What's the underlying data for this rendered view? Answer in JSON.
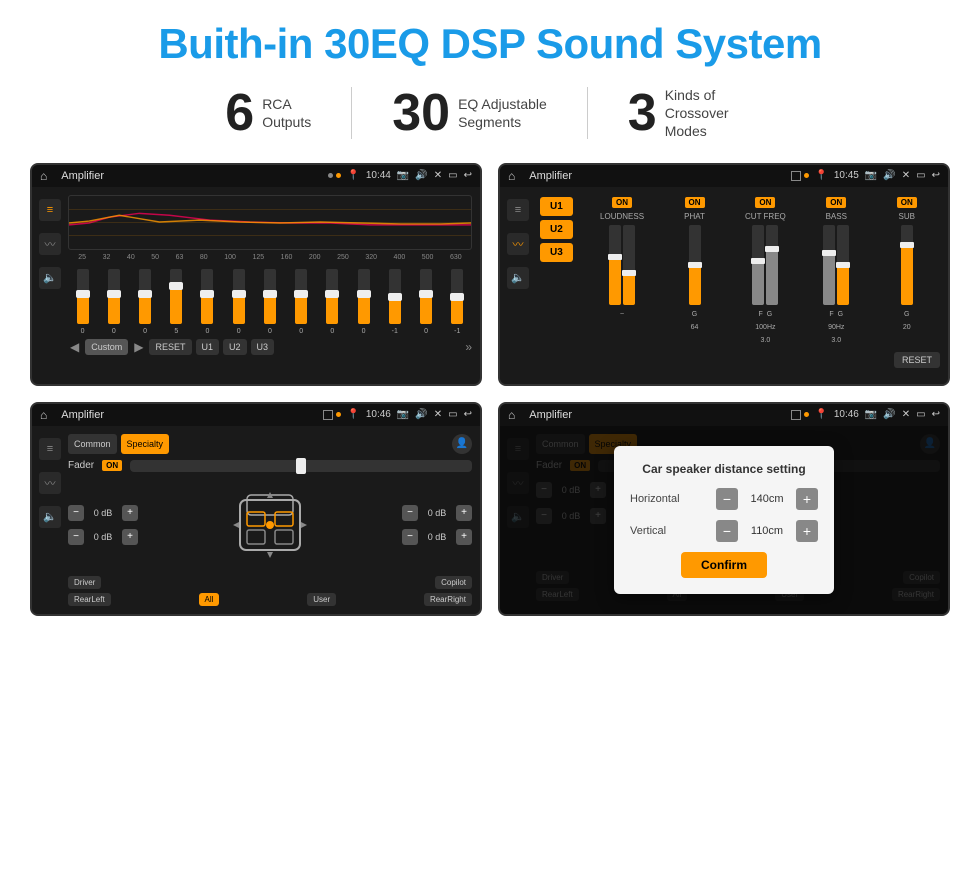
{
  "page": {
    "title": "Buith-in 30EQ DSP Sound System",
    "stats": [
      {
        "number": "6",
        "label": "RCA\nOutputs"
      },
      {
        "number": "30",
        "label": "EQ Adjustable\nSegments"
      },
      {
        "number": "3",
        "label": "Kinds of\nCrossover Modes"
      }
    ]
  },
  "screens": {
    "screen1": {
      "statusBar": {
        "title": "Amplifier",
        "time": "10:44"
      },
      "freqLabels": [
        "25",
        "32",
        "40",
        "50",
        "63",
        "80",
        "100",
        "125",
        "160",
        "200",
        "250",
        "320",
        "400",
        "500",
        "630"
      ],
      "sliderValues": [
        "0",
        "0",
        "0",
        "5",
        "0",
        "0",
        "0",
        "0",
        "0",
        "0",
        "-1",
        "0",
        "-1"
      ],
      "bottomButtons": [
        "Custom",
        "RESET",
        "U1",
        "U2",
        "U3"
      ]
    },
    "screen2": {
      "statusBar": {
        "title": "Amplifier",
        "time": "10:45"
      },
      "presets": [
        "U1",
        "U2",
        "U3"
      ],
      "channels": [
        "LOUDNESS",
        "PHAT",
        "CUT FREQ",
        "BASS",
        "SUB"
      ],
      "resetBtn": "RESET"
    },
    "screen3": {
      "statusBar": {
        "title": "Amplifier",
        "time": "10:46"
      },
      "tabs": [
        "Common",
        "Specialty"
      ],
      "fader": "Fader",
      "volumeRows": [
        {
          "value": "0 dB"
        },
        {
          "value": "0 dB"
        },
        {
          "value": "0 dB"
        },
        {
          "value": "0 dB"
        }
      ],
      "bottomBtns": [
        "Driver",
        "All",
        "User",
        "RearRight",
        "RearLeft",
        "Copilot"
      ]
    },
    "screen4": {
      "statusBar": {
        "title": "Amplifier",
        "time": "10:46"
      },
      "dialog": {
        "title": "Car speaker distance setting",
        "rows": [
          {
            "label": "Horizontal",
            "value": "140cm"
          },
          {
            "label": "Vertical",
            "value": "110cm"
          }
        ],
        "confirmBtn": "Confirm"
      },
      "volumeRows": [
        {
          "value": "0 dB"
        },
        {
          "value": "0 dB"
        }
      ]
    }
  },
  "icons": {
    "home": "⌂",
    "location": "📍",
    "volume": "🔊",
    "wifi": "📶",
    "back": "↩",
    "play": "▶",
    "pause": "⏸",
    "prev": "◀",
    "eq": "≡",
    "wave": "〰",
    "speaker": "🔈",
    "plus": "+",
    "minus": "−",
    "gear": "⚙",
    "car": "🚗",
    "arrowLeft": "❮",
    "arrowRight": "❯"
  },
  "colors": {
    "accent": "#f90",
    "bg": "#1a1a1a",
    "statusBg": "#111",
    "blue": "#1a9be8"
  }
}
